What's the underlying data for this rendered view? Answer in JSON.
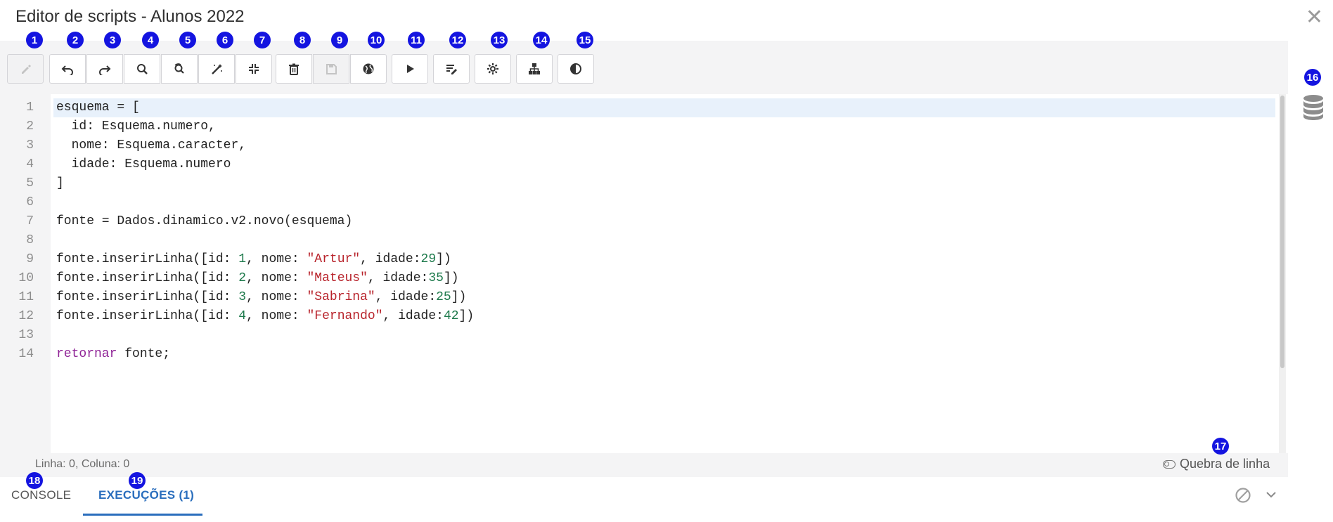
{
  "window": {
    "title": "Editor de scripts - Alunos 2022",
    "close_icon": "close-icon"
  },
  "toolbar": {
    "buttons": [
      {
        "name": "edit-button",
        "icon": "pencil-icon",
        "badge": "1",
        "enabled": false
      },
      {
        "name": "undo-button",
        "icon": "undo-icon",
        "badge": "2",
        "enabled": true
      },
      {
        "name": "redo-button",
        "icon": "redo-icon",
        "badge": "3",
        "enabled": true
      },
      {
        "name": "search-button",
        "icon": "search-icon",
        "badge": "4",
        "enabled": true
      },
      {
        "name": "replace-button",
        "icon": "search-replace-icon",
        "badge": "5",
        "enabled": true
      },
      {
        "name": "format-button",
        "icon": "magic-wand-icon",
        "badge": "6",
        "enabled": true
      },
      {
        "name": "collapse-button",
        "icon": "compress-icon",
        "badge": "7",
        "enabled": true
      },
      {
        "name": "delete-button",
        "icon": "trash-icon",
        "badge": "8",
        "enabled": true
      },
      {
        "name": "save-button",
        "icon": "save-icon",
        "badge": "9",
        "enabled": false
      },
      {
        "name": "publish-button",
        "icon": "globe-icon",
        "badge": "10",
        "enabled": true
      },
      {
        "name": "run-button",
        "icon": "play-icon",
        "badge": "11",
        "enabled": true
      },
      {
        "name": "edit-list-button",
        "icon": "list-edit-icon",
        "badge": "12",
        "enabled": true
      },
      {
        "name": "settings-button",
        "icon": "gear-icon",
        "badge": "13",
        "enabled": true
      },
      {
        "name": "structure-button",
        "icon": "sitemap-icon",
        "badge": "14",
        "enabled": true
      },
      {
        "name": "theme-toggle-button",
        "icon": "contrast-icon",
        "badge": "15",
        "enabled": true
      }
    ]
  },
  "sidebar": {
    "database_icon": "database-icon",
    "badge": "16"
  },
  "editor": {
    "line_numbers": [
      "1",
      "2",
      "3",
      "4",
      "5",
      "6",
      "7",
      "8",
      "9",
      "10",
      "11",
      "12",
      "13",
      "14"
    ],
    "lines": [
      [
        {
          "t": "esquema = ["
        }
      ],
      [
        {
          "t": "  id: Esquema.numero,"
        }
      ],
      [
        {
          "t": "  nome: Esquema.caracter,"
        }
      ],
      [
        {
          "t": "  idade: Esquema.numero"
        }
      ],
      [
        {
          "t": "]"
        }
      ],
      [],
      [
        {
          "t": "fonte = Dados.dinamico.v2.novo(esquema)"
        }
      ],
      [],
      [
        {
          "t": "fonte.inserirLinha([id: "
        },
        {
          "t": "1",
          "c": "num"
        },
        {
          "t": ", nome: "
        },
        {
          "t": "\"Artur\"",
          "c": "str"
        },
        {
          "t": ", idade:"
        },
        {
          "t": "29",
          "c": "num"
        },
        {
          "t": "])"
        }
      ],
      [
        {
          "t": "fonte.inserirLinha([id: "
        },
        {
          "t": "2",
          "c": "num"
        },
        {
          "t": ", nome: "
        },
        {
          "t": "\"Mateus\"",
          "c": "str"
        },
        {
          "t": ", idade:"
        },
        {
          "t": "35",
          "c": "num"
        },
        {
          "t": "])"
        }
      ],
      [
        {
          "t": "fonte.inserirLinha([id: "
        },
        {
          "t": "3",
          "c": "num"
        },
        {
          "t": ", nome: "
        },
        {
          "t": "\"Sabrina\"",
          "c": "str"
        },
        {
          "t": ", idade:"
        },
        {
          "t": "25",
          "c": "num"
        },
        {
          "t": "])"
        }
      ],
      [
        {
          "t": "fonte.inserirLinha([id: "
        },
        {
          "t": "4",
          "c": "num"
        },
        {
          "t": ", nome: "
        },
        {
          "t": "\"Fernando\"",
          "c": "str"
        },
        {
          "t": ", idade:"
        },
        {
          "t": "42",
          "c": "num"
        },
        {
          "t": "])"
        }
      ],
      [],
      [
        {
          "t": "retornar",
          "c": "kw"
        },
        {
          "t": " fonte;"
        }
      ]
    ]
  },
  "status": {
    "position_text": "Linha: 0, Coluna: 0",
    "wrap_label": "Quebra de linha",
    "wrap_badge": "17"
  },
  "bottom_tabs": [
    {
      "label": "CONSOLE",
      "badge": "18",
      "active": false
    },
    {
      "label": "EXECUÇÕES (1)",
      "badge": "19",
      "active": true
    }
  ],
  "colors": {
    "badge": "#1414e0",
    "active_tab": "#2a6ebd",
    "keyword": "#8f2396",
    "number": "#1e7a4c",
    "string": "#b8232b"
  }
}
